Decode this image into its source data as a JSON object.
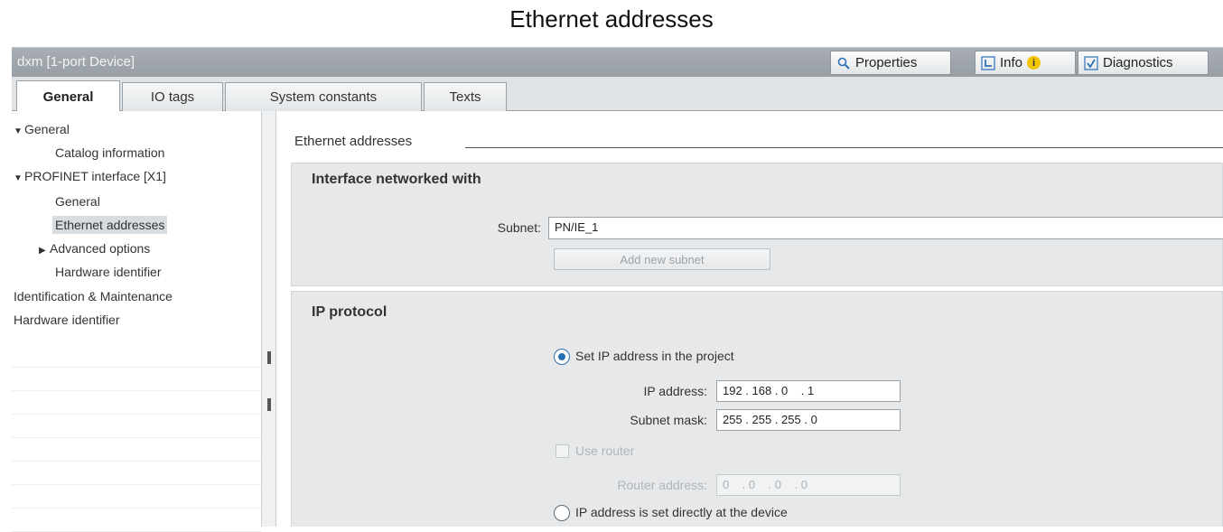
{
  "caption": "Ethernet addresses",
  "window": {
    "title": "dxm [1-port Device]",
    "buttons": {
      "properties": "Properties",
      "info": "Info",
      "diagnostics": "Diagnostics"
    }
  },
  "tabs": [
    {
      "label": "General",
      "active": true
    },
    {
      "label": "IO tags"
    },
    {
      "label": "System constants"
    },
    {
      "label": "Texts"
    }
  ],
  "sidebar": {
    "items": [
      {
        "label": "General"
      },
      {
        "label": "Catalog information"
      },
      {
        "label": "PROFINET interface [X1]"
      },
      {
        "label": "General"
      },
      {
        "label": "Ethernet addresses",
        "selected": true
      },
      {
        "label": "Advanced options"
      },
      {
        "label": "Hardware identifier"
      },
      {
        "label": "Identification & Maintenance"
      },
      {
        "label": "Hardware identifier"
      }
    ]
  },
  "content": {
    "section_title": "Ethernet addresses",
    "interface": {
      "title": "Interface networked with",
      "subnet_label": "Subnet:",
      "subnet_value": "PN/IE_1",
      "add_subnet_button": "Add new subnet"
    },
    "ip_protocol": {
      "title": "IP protocol",
      "set_in_project_label": "Set IP address in the project",
      "ip_address_label": "IP address:",
      "ip_address_value": "192 . 168 . 0    . 1",
      "subnet_mask_label": "Subnet mask:",
      "subnet_mask_value": "255 . 255 . 255 . 0",
      "use_router_label": "Use router",
      "router_address_label": "Router address:",
      "router_address_value": "0    . 0    . 0    . 0",
      "set_directly_label": "IP address is set directly at the device"
    }
  }
}
